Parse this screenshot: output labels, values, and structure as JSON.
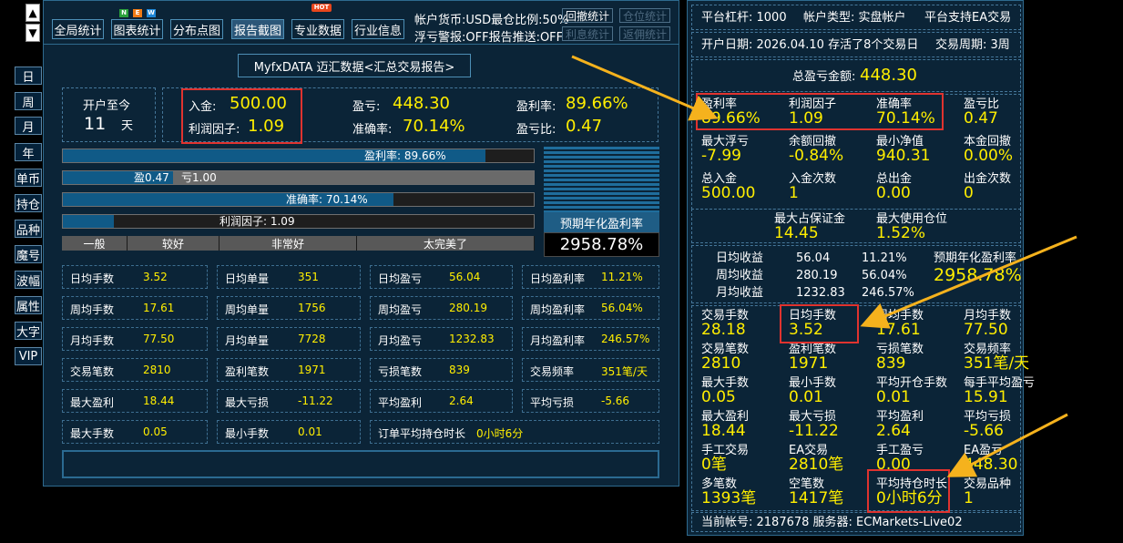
{
  "side": {
    "up": "▲",
    "down": "▼"
  },
  "left_nav": [
    "日",
    "周",
    "月",
    "年",
    "单币",
    "持仓",
    "品种",
    "魔号",
    "波幅",
    "属性",
    "大字",
    "VIP"
  ],
  "toolbar": {
    "buttons": [
      {
        "label": "全局统计"
      },
      {
        "label": "图表统计"
      },
      {
        "label": "分布点图"
      },
      {
        "label": "报告截图"
      },
      {
        "label": "专业数据"
      },
      {
        "label": "行业信息"
      }
    ],
    "new_badge": [
      "N",
      "E",
      "W"
    ],
    "hot_badge": "HOT",
    "status1": "帐户货币:USD最仓比例:50%",
    "status2": "浮亏警报:OFF报告推送:OFF",
    "small_buttons": [
      "回撤统计",
      "仓位统计",
      "利息统计",
      "返佣统计"
    ]
  },
  "report_title": "MyfxDATA 迈汇数据<汇总交易报告>",
  "since": {
    "label": "开户至今",
    "value": "11",
    "unit": "天"
  },
  "summary": {
    "deposit_label": "入金:",
    "deposit": "500.00",
    "pl_label": "盈亏:",
    "pl": "448.30",
    "profit_rate_label": "盈利率:",
    "profit_rate": "89.66%",
    "pf_label": "利润因子:",
    "pf": "1.09",
    "accuracy_label": "准确率:",
    "accuracy": "70.14%",
    "plr_label": "盈亏比:",
    "plr": "0.47"
  },
  "bars": {
    "profit_rate": {
      "label": "盈利率: 89.66%",
      "fraction": 0.8966
    },
    "ratio": {
      "win_label": "盈0.47",
      "loss_label": "亏1.00",
      "fraction": 0.235
    },
    "accuracy": {
      "label": "准确率: 70.14%",
      "fraction": 0.7014
    },
    "pf": {
      "label": "利润因子: 1.09",
      "fraction": 0.109
    }
  },
  "scale": [
    "一般",
    "较好",
    "非常好",
    "太完美了"
  ],
  "annual": {
    "label": "预期年化盈利率",
    "value": "2958.78%"
  },
  "grid": [
    [
      [
        "日均手数",
        "3.52"
      ],
      [
        "日均单量",
        "351"
      ],
      [
        "日均盈亏",
        "56.04"
      ],
      [
        "日均盈利率",
        "11.21%"
      ]
    ],
    [
      [
        "周均手数",
        "17.61"
      ],
      [
        "周均单量",
        "1756"
      ],
      [
        "周均盈亏",
        "280.19"
      ],
      [
        "周均盈利率",
        "56.04%"
      ]
    ],
    [
      [
        "月均手数",
        "77.50"
      ],
      [
        "月均单量",
        "7728"
      ],
      [
        "月均盈亏",
        "1232.83"
      ],
      [
        "月均盈利率",
        "246.57%"
      ]
    ],
    [
      [
        "交易笔数",
        "2810"
      ],
      [
        "盈利笔数",
        "1971"
      ],
      [
        "亏损笔数",
        "839"
      ],
      [
        "交易频率",
        "351笔/天"
      ]
    ],
    [
      [
        "最大盈利",
        "18.44"
      ],
      [
        "最大亏损",
        "-11.22"
      ],
      [
        "平均盈利",
        "2.64"
      ],
      [
        "平均亏损",
        "-5.66"
      ]
    ]
  ],
  "grid_last": [
    [
      "最大手数",
      "0.05"
    ],
    [
      "最小手数",
      "0.01"
    ],
    [
      "订单平均持仓时长",
      "0小时6分"
    ]
  ],
  "right": {
    "leverage": "平台杠杆: 1000",
    "account_type": "帐户类型: 实盘帐户",
    "ea_support": "平台支持EA交易",
    "open_date": "开户日期: 2026.04.10 存活了8个交易日",
    "period": "交易周期: 3周",
    "total_pl_label": "总盈亏金额:",
    "total_pl": "448.30",
    "rows": [
      [
        [
          "盈利率",
          "89.66%"
        ],
        [
          "利润因子",
          "1.09"
        ],
        [
          "准确率",
          "70.14%"
        ],
        [
          "盈亏比",
          "0.47"
        ]
      ],
      [
        [
          "最大浮亏",
          "-7.99"
        ],
        [
          "余额回撤",
          "-0.84%"
        ],
        [
          "最小净值",
          "940.31"
        ],
        [
          "本金回撤",
          "0.00%"
        ]
      ],
      [
        [
          "总入金",
          "500.00"
        ],
        [
          "入金次数",
          "1"
        ],
        [
          "总出金",
          "0.00"
        ],
        [
          "出金次数",
          "0"
        ]
      ]
    ],
    "margin": [
      [
        "最大占保证金",
        "14.45"
      ],
      [
        "最大使用仓位",
        "1.52%"
      ]
    ],
    "income": [
      [
        "日均收益",
        "56.04",
        "11.21%"
      ],
      [
        "周均收益",
        "280.19",
        "56.04%"
      ],
      [
        "月均收益",
        "1232.83",
        "246.57%"
      ]
    ],
    "annual_label": "预期年化盈利率",
    "annual_value": "2958.78%",
    "rows2": [
      [
        [
          "交易手数",
          "28.18"
        ],
        [
          "日均手数",
          "3.52"
        ],
        [
          "周均手数",
          "17.61"
        ],
        [
          "月均手数",
          "77.50"
        ]
      ],
      [
        [
          "交易笔数",
          "2810"
        ],
        [
          "盈利笔数",
          "1971"
        ],
        [
          "亏损笔数",
          "839"
        ],
        [
          "交易频率",
          "351笔/天"
        ]
      ],
      [
        [
          "最大手数",
          "0.05"
        ],
        [
          "最小手数",
          "0.01"
        ],
        [
          "平均开仓手数",
          "0.01"
        ],
        [
          "每手平均盈亏",
          "15.91"
        ]
      ],
      [
        [
          "最大盈利",
          "18.44"
        ],
        [
          "最大亏损",
          "-11.22"
        ],
        [
          "平均盈利",
          "2.64"
        ],
        [
          "平均亏损",
          "-5.66"
        ]
      ],
      [
        [
          "手工交易",
          "0笔"
        ],
        [
          "EA交易",
          "2810笔"
        ],
        [
          "手工盈亏",
          "0.00"
        ],
        [
          "EA盈亏",
          "448.30"
        ]
      ],
      [
        [
          "多笔数",
          "1393笔"
        ],
        [
          "空笔数",
          "1417笔"
        ],
        [
          "平均持仓时长",
          "0小时6分"
        ],
        [
          "交易品种",
          "1"
        ]
      ]
    ],
    "footer": "当前帐号: 2187678 服务器: ECMarkets-Live02"
  },
  "colors": {
    "panel": "#0b2437",
    "accent_yellow": "#ffee00",
    "highlight_red": "#e0332f",
    "arrow": "#f5b21d",
    "bar_fill": "#105a87"
  }
}
